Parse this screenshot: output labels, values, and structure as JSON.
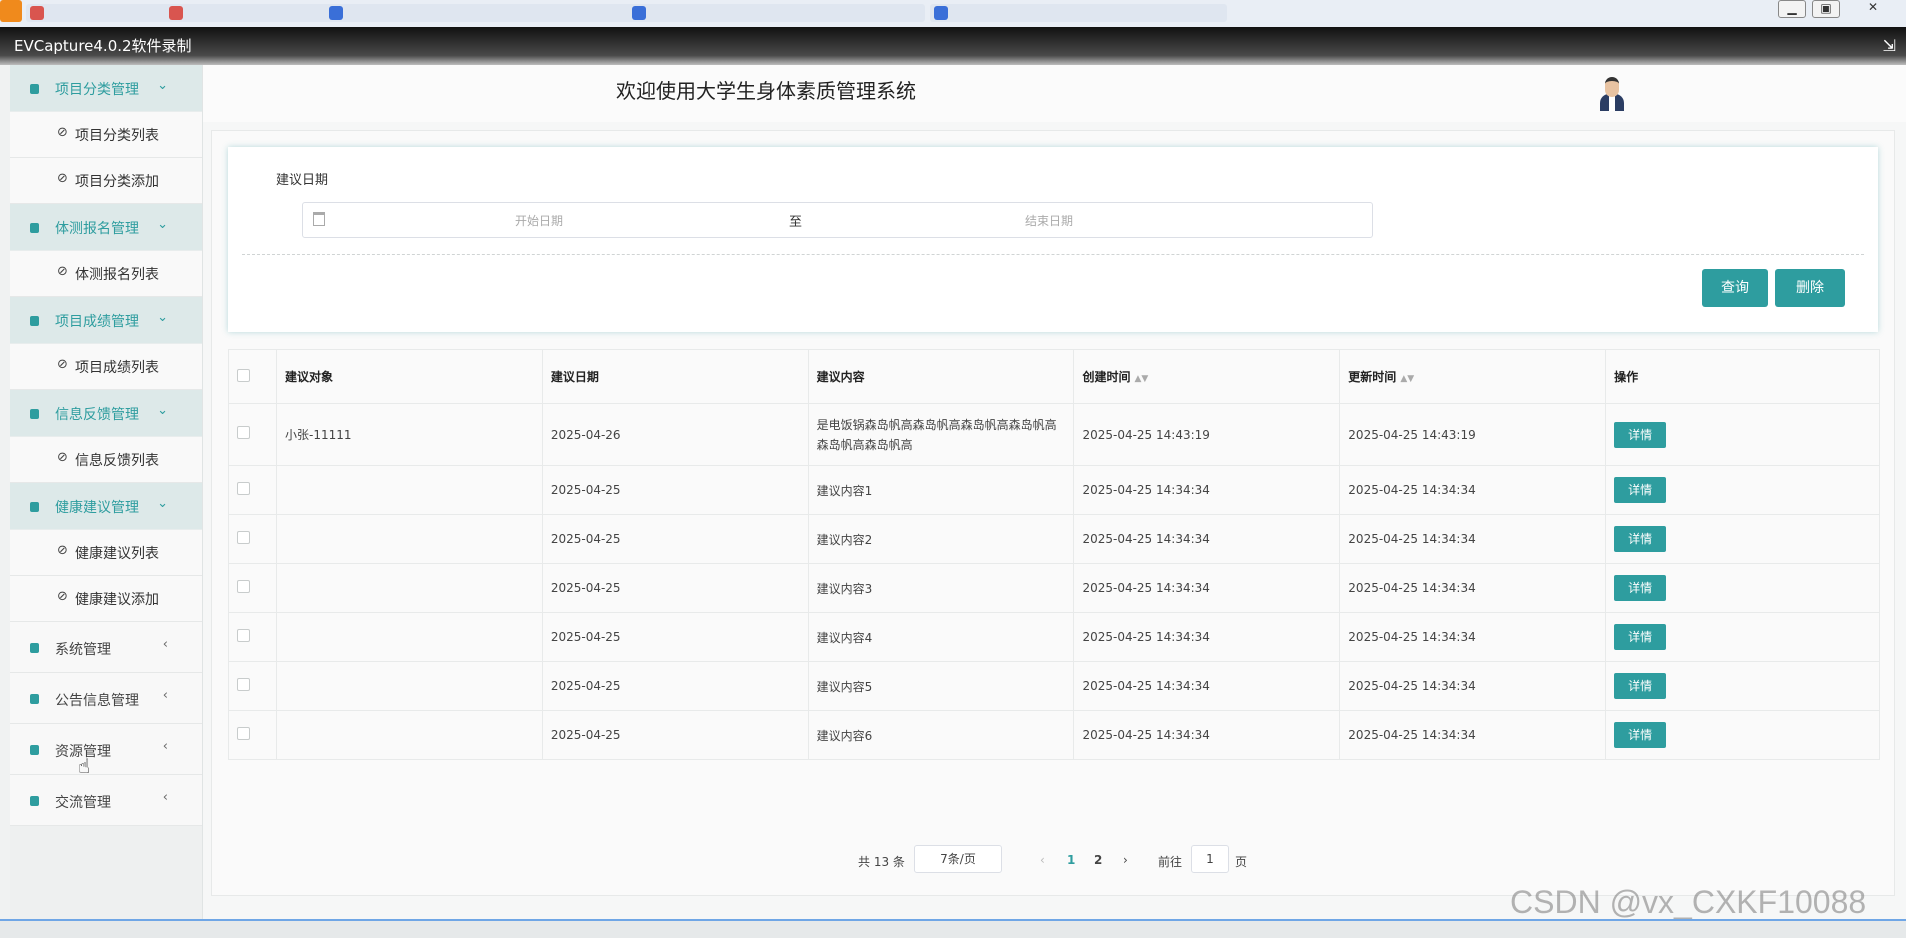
{
  "capture_title": "EVCapture4.0.2软件录制",
  "header": {
    "title": "欢迎使用大学生身体素质管理系统"
  },
  "sidebar": {
    "groups": [
      {
        "label": "项目分类管理",
        "expanded": true,
        "items": [
          "项目分类列表",
          "项目分类添加"
        ]
      },
      {
        "label": "体测报名管理",
        "expanded": true,
        "items": [
          "体测报名列表"
        ]
      },
      {
        "label": "项目成绩管理",
        "expanded": true,
        "items": [
          "项目成绩列表"
        ]
      },
      {
        "label": "信息反馈管理",
        "expanded": true,
        "items": [
          "信息反馈列表"
        ]
      },
      {
        "label": "健康建议管理",
        "expanded": true,
        "items": [
          "健康建议列表",
          "健康建议添加"
        ]
      },
      {
        "label": "系统管理",
        "expanded": false,
        "items": []
      },
      {
        "label": "公告信息管理",
        "expanded": false,
        "items": []
      },
      {
        "label": "资源管理",
        "expanded": false,
        "items": []
      },
      {
        "label": "交流管理",
        "expanded": false,
        "items": []
      }
    ]
  },
  "search": {
    "label": "建议日期",
    "start_placeholder": "开始日期",
    "separator": "至",
    "end_placeholder": "结束日期",
    "query_label": "查询",
    "delete_label": "删除"
  },
  "table": {
    "headers": [
      "建议对象",
      "建议日期",
      "建议内容",
      "创建时间",
      "更新时间",
      "操作"
    ],
    "detail_label": "详情",
    "rows": [
      {
        "target": "小张-11111",
        "date": "2025-04-26",
        "content": "是电饭锅森岛帆高森岛帆高森岛帆高森岛帆高森岛帆高森岛帆高",
        "created": "2025-04-25 14:43:19",
        "updated": "2025-04-25 14:43:19"
      },
      {
        "target": "",
        "date": "2025-04-25",
        "content": "建议内容1",
        "created": "2025-04-25 14:34:34",
        "updated": "2025-04-25 14:34:34"
      },
      {
        "target": "",
        "date": "2025-04-25",
        "content": "建议内容2",
        "created": "2025-04-25 14:34:34",
        "updated": "2025-04-25 14:34:34"
      },
      {
        "target": "",
        "date": "2025-04-25",
        "content": "建议内容3",
        "created": "2025-04-25 14:34:34",
        "updated": "2025-04-25 14:34:34"
      },
      {
        "target": "",
        "date": "2025-04-25",
        "content": "建议内容4",
        "created": "2025-04-25 14:34:34",
        "updated": "2025-04-25 14:34:34"
      },
      {
        "target": "",
        "date": "2025-04-25",
        "content": "建议内容5",
        "created": "2025-04-25 14:34:34",
        "updated": "2025-04-25 14:34:34"
      },
      {
        "target": "",
        "date": "2025-04-25",
        "content": "建议内容6",
        "created": "2025-04-25 14:34:34",
        "updated": "2025-04-25 14:34:34"
      }
    ]
  },
  "pagination": {
    "total": "共 13 条",
    "page_size": "7条/页",
    "prev": "‹",
    "pages": [
      "1",
      "2"
    ],
    "current": "1",
    "next": "›",
    "goto_prefix": "前往",
    "goto_value": "1",
    "goto_suffix": "页"
  },
  "watermark": "CSDN @vx_CXKF10088"
}
